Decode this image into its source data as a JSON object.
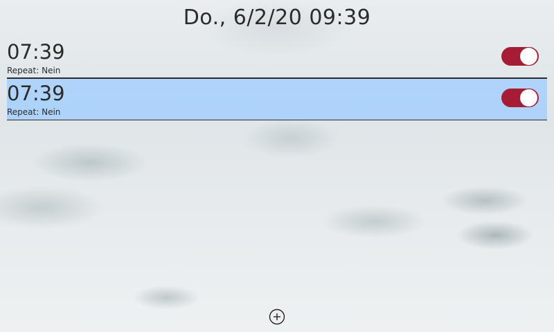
{
  "header": {
    "datetime": "Do., 6/2/20 09:39"
  },
  "alarms": [
    {
      "time": "07:39",
      "repeat": "Repeat: Nein",
      "enabled": true,
      "selected": false
    },
    {
      "time": "07:39",
      "repeat": "Repeat: Nein",
      "enabled": true,
      "selected": true
    }
  ],
  "toolbar": {
    "add_icon": "plus-circle-icon"
  },
  "colors": {
    "toggle_on": "#a71c35",
    "selection": "#a0cdff"
  }
}
